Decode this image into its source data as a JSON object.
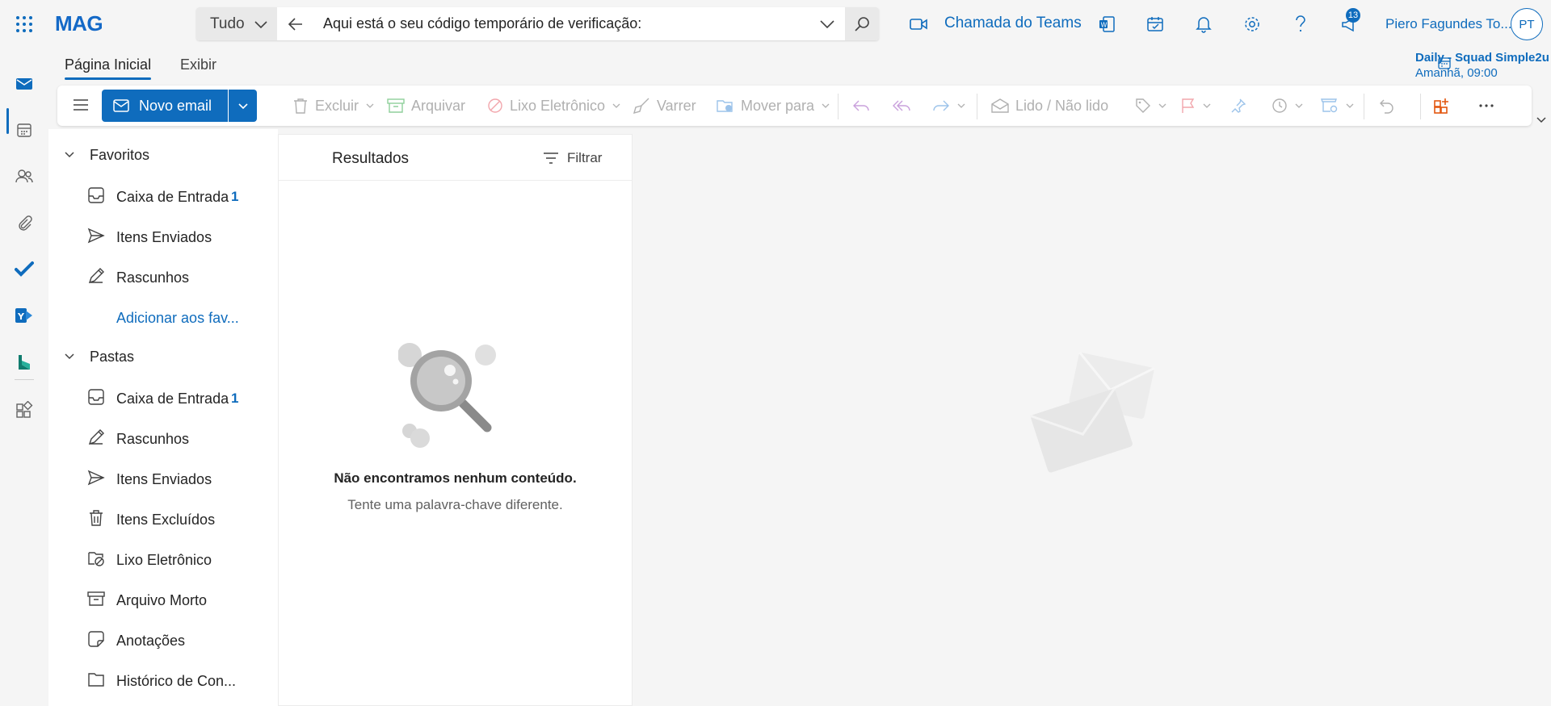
{
  "app": {
    "brand": "MAG"
  },
  "search": {
    "scope": "Tudo",
    "query": "Aqui está o seu código temporário de verificação:"
  },
  "header": {
    "teams_call_label": "Chamada do Teams",
    "notifications_badge": "13",
    "user_name": "Piero Fagundes To...",
    "avatar_initials": "PT"
  },
  "tabs": [
    {
      "label": "Página Inicial",
      "active": true
    },
    {
      "label": "Exibir",
      "active": false
    }
  ],
  "upcoming": {
    "title": "Daily - Squad Simple2u",
    "time": "Amanhã, 09:00"
  },
  "ribbon": {
    "new_email": "Novo email",
    "delete": "Excluir",
    "archive": "Arquivar",
    "junk": "Lixo Eletrônico",
    "sweep": "Varrer",
    "move_to": "Mover para",
    "read_unread": "Lido / Não lido"
  },
  "folders": {
    "favorites_label": "Favoritos",
    "favorites": [
      {
        "label": "Caixa de Entrada",
        "count": "1",
        "icon": "inbox-icon"
      },
      {
        "label": "Itens Enviados",
        "count": "",
        "icon": "send-icon"
      },
      {
        "label": "Rascunhos",
        "count": "",
        "icon": "draft-icon"
      },
      {
        "label": "Adicionar aos fav...",
        "count": "",
        "icon": ""
      }
    ],
    "folders_label": "Pastas",
    "items": [
      {
        "label": "Caixa de Entrada",
        "count": "1",
        "icon": "inbox-icon"
      },
      {
        "label": "Rascunhos",
        "count": "",
        "icon": "draft-icon"
      },
      {
        "label": "Itens Enviados",
        "count": "",
        "icon": "send-icon"
      },
      {
        "label": "Itens Excluídos",
        "count": "",
        "icon": "trash-icon"
      },
      {
        "label": "Lixo Eletrônico",
        "count": "",
        "icon": "junk-icon"
      },
      {
        "label": "Arquivo Morto",
        "count": "",
        "icon": "archive-icon"
      },
      {
        "label": "Anotações",
        "count": "",
        "icon": "note-icon"
      },
      {
        "label": "Histórico de Con...",
        "count": "",
        "icon": "folder-icon"
      }
    ]
  },
  "results": {
    "title": "Resultados",
    "filter_label": "Filtrar",
    "empty_title": "Não encontramos nenhum conteúdo.",
    "empty_subtitle": "Tente uma palavra-chave diferente."
  },
  "colors": {
    "accent": "#0f6cbd",
    "surface": "#f5f5f5"
  }
}
